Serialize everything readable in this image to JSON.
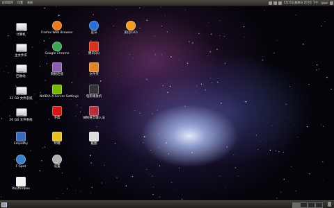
{
  "top_panel": {
    "menus": [
      "应用程序",
      "位置",
      "系统"
    ],
    "right_text": "5月15日星期日 20:01 下午",
    "user": "Ubnt"
  },
  "desktop_icons": [
    {
      "label": "计算机",
      "icon": "computer-icon",
      "color": "#e8e8e8"
    },
    {
      "label": "Firefox Web Browser",
      "icon": "firefox-icon",
      "color": "#e87a20"
    },
    {
      "label": "蓝牙",
      "icon": "bluetooth-icon",
      "color": "#2a6fd6"
    },
    {
      "label": "美化(GO)",
      "icon": "beautify-icon",
      "color": "#f0a020"
    },
    {
      "label": "主文件夹",
      "icon": "home-folder-icon",
      "color": "#e8e8e8"
    },
    {
      "label": "Google Chrome",
      "icon": "chrome-icon",
      "color": "#3aa757"
    },
    {
      "label": "腾讯QQ",
      "icon": "qq-icon",
      "color": "#d8321e"
    },
    {
      "label": "回收站",
      "icon": "trash-icon",
      "color": "#e8e8e8"
    },
    {
      "label": "网络连接",
      "icon": "network-icon",
      "color": "#8a5fb0"
    },
    {
      "label": "文件夹",
      "icon": "folder-icon",
      "color": "#e0842a"
    },
    {
      "label": "32 GB 文件系统",
      "icon": "drive-icon",
      "color": "#e8e8e8"
    },
    {
      "label": "NVIDIA X Server Settings",
      "icon": "nvidia-icon",
      "color": "#76b900"
    },
    {
      "label": "电影播放机",
      "icon": "movie-player-icon",
      "color": "#333333"
    },
    {
      "label": "26 GB 文件系统",
      "icon": "drive-icon",
      "color": "#e8e8e8"
    },
    {
      "label": "字典",
      "icon": "dictionary-icon",
      "color": "#d01818"
    },
    {
      "label": "搜狗拼音输入法",
      "icon": "sogou-icon",
      "color": "#b03040"
    },
    {
      "label": "Empathy",
      "icon": "empathy-icon",
      "color": "#3a6ab8"
    },
    {
      "label": "终端",
      "icon": "terminal-icon",
      "color": "#e6c02a"
    },
    {
      "label": "截图",
      "icon": "screenshot-icon",
      "color": "#dddddd"
    },
    {
      "label": "F-Spot",
      "icon": "fspot-icon",
      "color": "#3a80c8"
    },
    {
      "label": "设置",
      "icon": "settings-icon",
      "color": "#b0b0b0"
    },
    {
      "label": "Rhythmbox",
      "icon": "rhythmbox-icon",
      "color": "#f2f2f2"
    }
  ]
}
